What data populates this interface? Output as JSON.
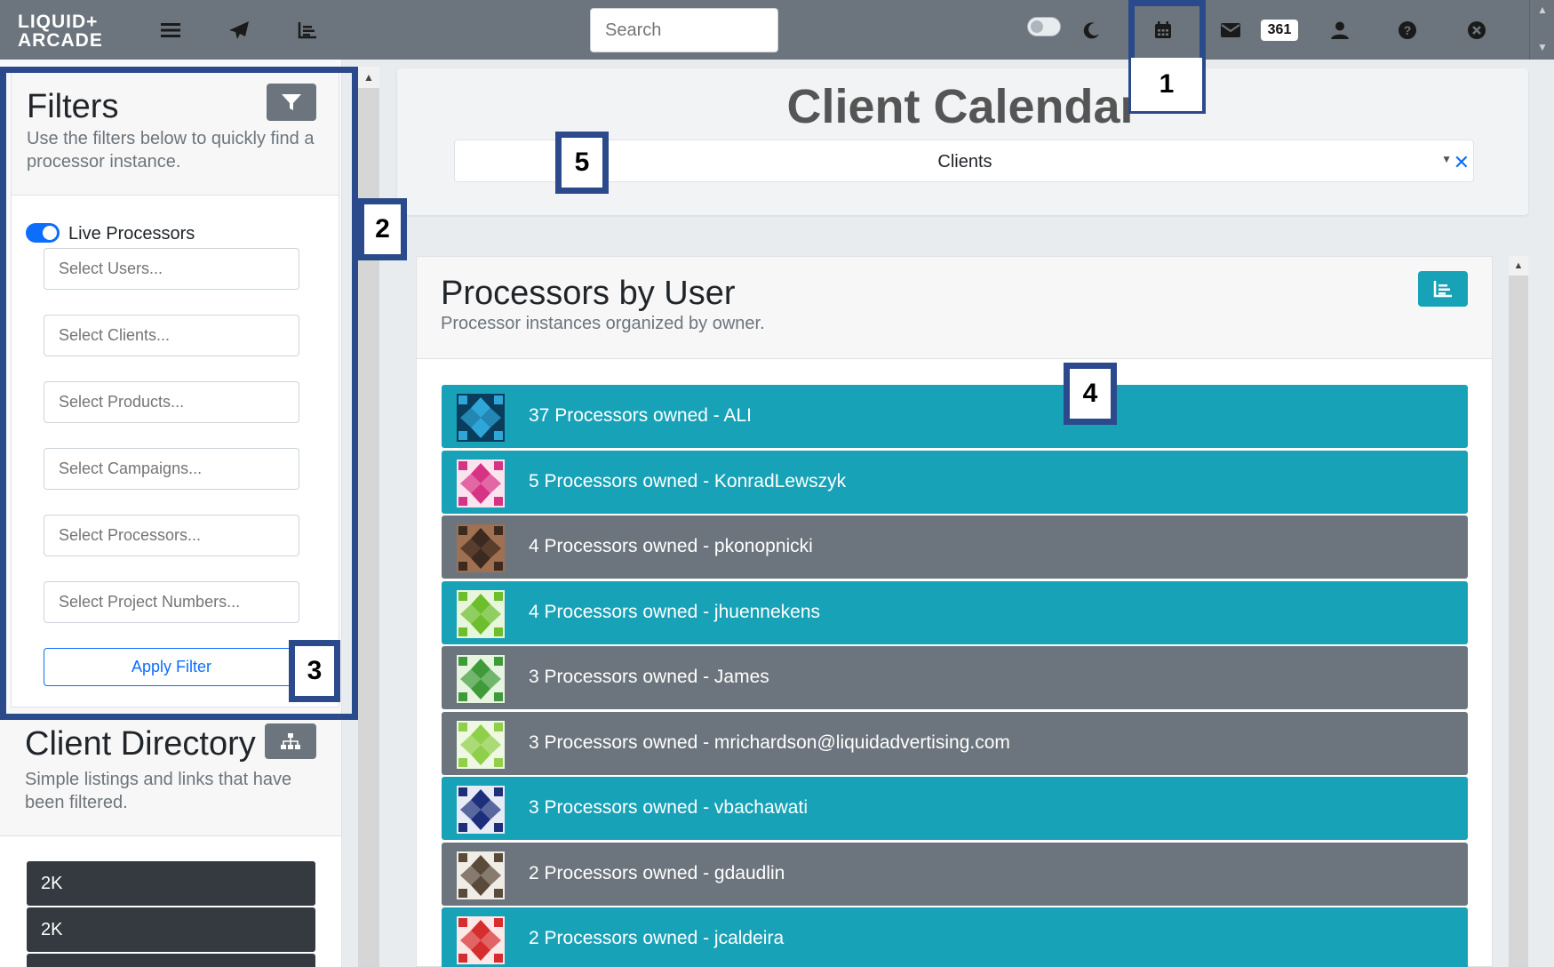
{
  "navbar": {
    "logo_line1": "LIQUID+",
    "logo_line2": "ARCADE",
    "search_placeholder": "Search",
    "notifications_count": "361",
    "icons": [
      "menu-icon",
      "paper-plane-icon",
      "chart-icon",
      "toggle-switch",
      "moon-icon",
      "calendar-icon",
      "envelope-icon",
      "user-icon",
      "help-icon",
      "close-icon"
    ]
  },
  "filters": {
    "title": "Filters",
    "description": "Use the filters below to quickly find a processor instance.",
    "live_label": "Live Processors",
    "live_enabled": true,
    "inputs": [
      {
        "placeholder": "Select Users..."
      },
      {
        "placeholder": "Select Clients..."
      },
      {
        "placeholder": "Select Products..."
      },
      {
        "placeholder": "Select Campaigns..."
      },
      {
        "placeholder": "Select Processors..."
      },
      {
        "placeholder": "Select Project Numbers..."
      }
    ],
    "apply_label": "Apply Filter"
  },
  "directory": {
    "title": "Client Directory",
    "description": "Simple listings and links that have been filtered.",
    "items": [
      "2K",
      "2K"
    ]
  },
  "calendar": {
    "title": "Client Calendar",
    "select_value": "Clients"
  },
  "processors": {
    "title": "Processors by User",
    "description": "Processor instances organized by owner.",
    "rows": [
      {
        "label": "37 Processors owned - ALI",
        "style": "teal",
        "avatar": "ai-face"
      },
      {
        "label": "5 Processors owned - KonradLewszyk",
        "style": "teal",
        "avatar": "pink-pattern"
      },
      {
        "label": "4 Processors owned - pkonopnicki",
        "style": "gray",
        "avatar": "photo"
      },
      {
        "label": "4 Processors owned - jhuennekens",
        "style": "teal",
        "avatar": "green-pattern"
      },
      {
        "label": "3 Processors owned - James",
        "style": "gray",
        "avatar": "green-pattern-2"
      },
      {
        "label": "3 Processors owned - mrichardson@liquidadvertising.com",
        "style": "gray",
        "avatar": "lime-pattern"
      },
      {
        "label": "3 Processors owned - vbachawati",
        "style": "teal",
        "avatar": "navy-pattern"
      },
      {
        "label": "2 Processors owned - gdaudlin",
        "style": "gray",
        "avatar": "brown-pattern"
      },
      {
        "label": "2 Processors owned - jcaldeira",
        "style": "teal",
        "avatar": "red-pattern"
      }
    ]
  },
  "annotations": [
    "1",
    "2",
    "3",
    "4",
    "5"
  ],
  "colors": {
    "navbar": "#6c757d",
    "teal": "#17a2b8",
    "gray": "#6c757d",
    "annotation": "#2b4a8c",
    "primary": "#0d6efd"
  }
}
